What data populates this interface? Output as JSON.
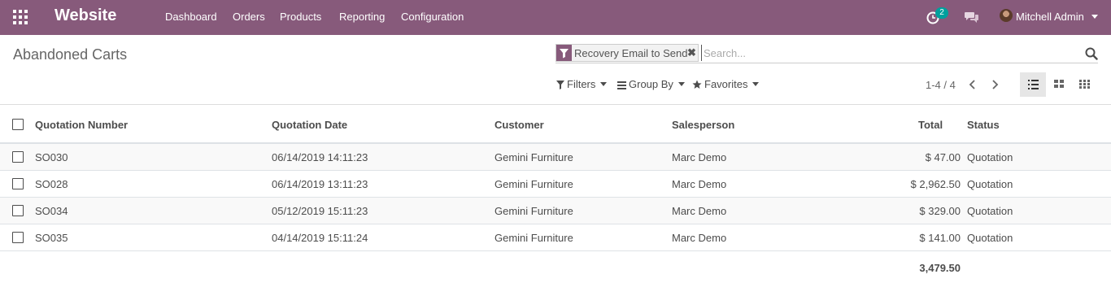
{
  "navbar": {
    "brand": "Website",
    "menu": [
      {
        "label": "Dashboard"
      },
      {
        "label": "Orders"
      },
      {
        "label": "Products"
      },
      {
        "label": "Reporting"
      },
      {
        "label": "Configuration"
      }
    ],
    "activity_count": "2",
    "user_name": "Mitchell Admin",
    "icons": {
      "apps": "grid-icon",
      "activity": "clock-icon",
      "chat": "chat-bubbles-icon"
    }
  },
  "control_panel": {
    "breadcrumb": "Abandoned Carts",
    "search": {
      "facet_value": "Recovery Email to Send",
      "facet_remove": "✖",
      "placeholder": "Search..."
    },
    "filters_label": "Filters",
    "groupby_label": "Group By",
    "favorites_label": "Favorites",
    "pager": "1-4 / 4"
  },
  "table": {
    "headers": {
      "number": "Quotation Number",
      "date": "Quotation Date",
      "customer": "Customer",
      "salesperson": "Salesperson",
      "total": "Total",
      "status": "Status"
    },
    "rows": [
      {
        "number": "SO030",
        "date": "06/14/2019 14:11:23",
        "customer": "Gemini Furniture",
        "salesperson": "Marc Demo",
        "total": "$ 47.00",
        "status": "Quotation"
      },
      {
        "number": "SO028",
        "date": "06/14/2019 13:11:23",
        "customer": "Gemini Furniture",
        "salesperson": "Marc Demo",
        "total": "$ 2,962.50",
        "status": "Quotation"
      },
      {
        "number": "SO034",
        "date": "05/12/2019 15:11:23",
        "customer": "Gemini Furniture",
        "salesperson": "Marc Demo",
        "total": "$ 329.00",
        "status": "Quotation"
      },
      {
        "number": "SO035",
        "date": "04/14/2019 15:11:24",
        "customer": "Gemini Furniture",
        "salesperson": "Marc Demo",
        "total": "$ 141.00",
        "status": "Quotation"
      }
    ],
    "footer_total": "3,479.50"
  },
  "colors": {
    "brand": "#875a7b",
    "badge": "#00a09d"
  }
}
